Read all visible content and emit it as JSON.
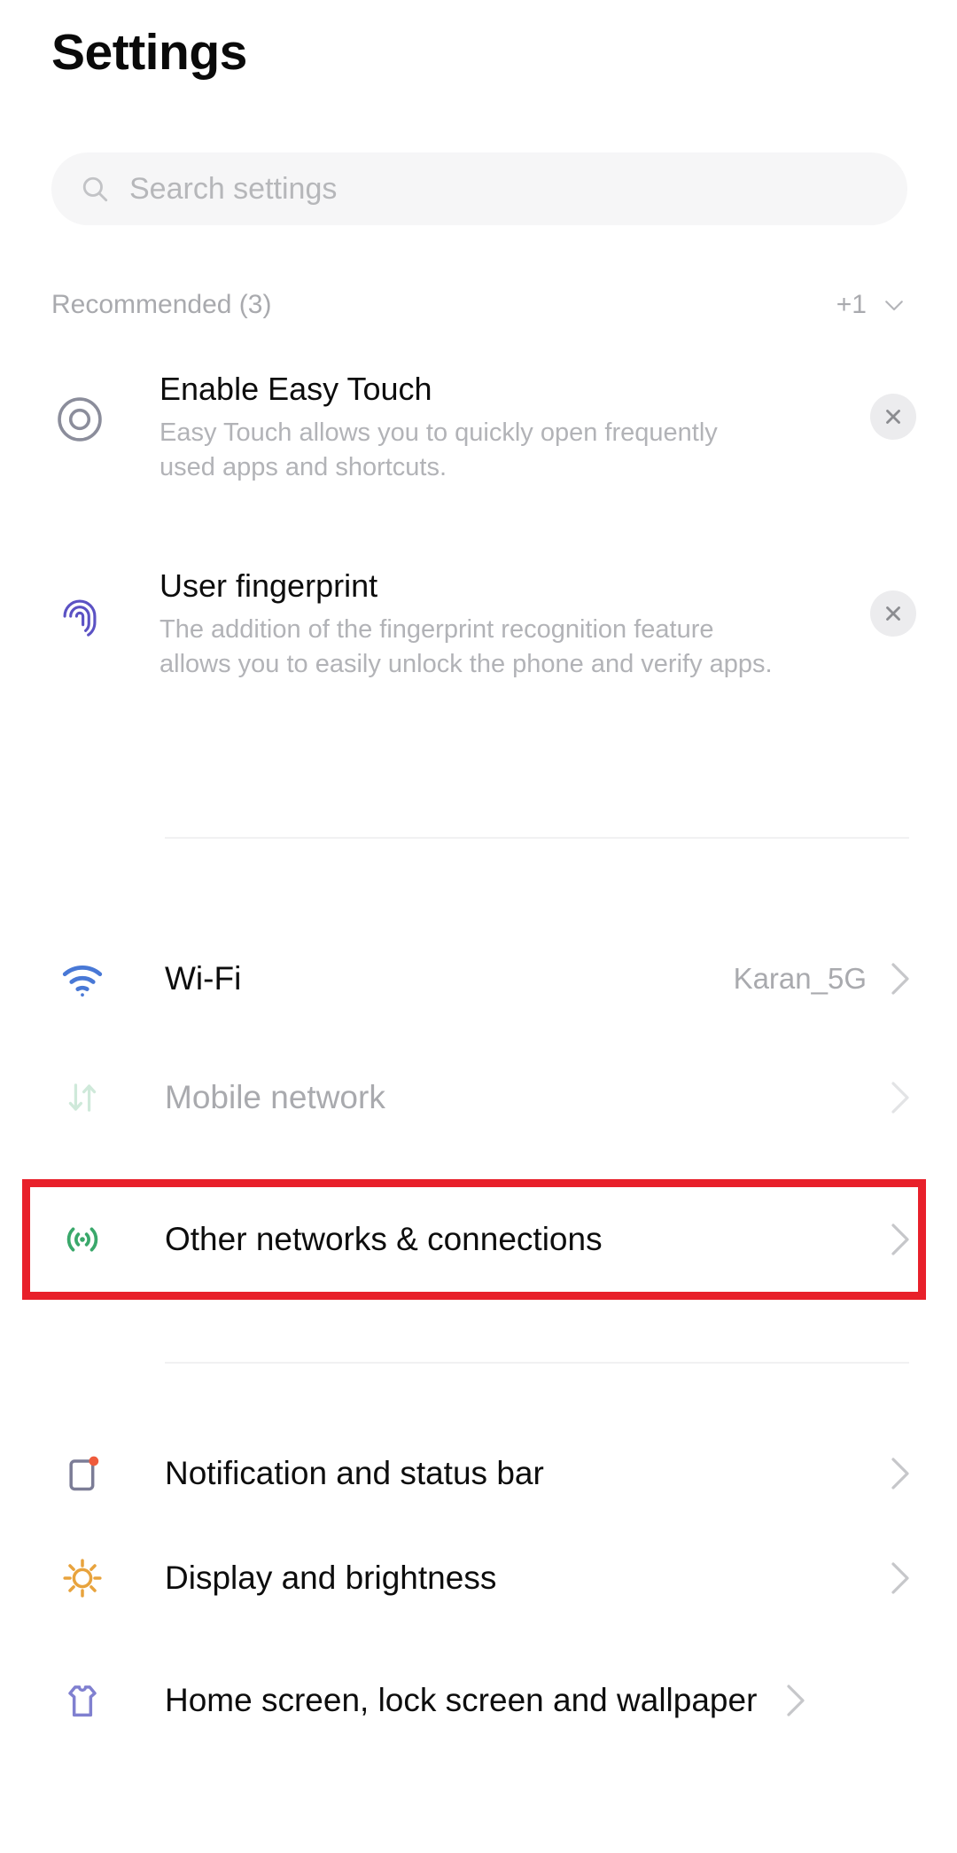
{
  "header": {
    "title": "Settings"
  },
  "search": {
    "placeholder": "Search settings",
    "icon": "search-icon"
  },
  "recommended": {
    "title": "Recommended (3)",
    "more_count": "+1",
    "expand_icon": "chevron-down-icon",
    "items": [
      {
        "name": "Enable Easy Touch",
        "description": "Easy Touch allows you to quickly open frequently used apps and shortcuts.",
        "icon": "easy-touch-icon",
        "icon_color": "#8b8d9b",
        "dismiss_icon": "close-icon"
      },
      {
        "name": "User fingerprint",
        "description": "The addition of the fingerprint recognition feature allows you to easily unlock the phone and verify apps.",
        "icon": "fingerprint-icon",
        "icon_color": "#5b52c4",
        "dismiss_icon": "close-icon"
      }
    ]
  },
  "network_group": {
    "rows": [
      {
        "label": "Wi-Fi",
        "value": "Karan_5G",
        "icon": "wifi-icon",
        "icon_color": "#4878d6",
        "chevron": "chevron-right-icon",
        "dimmed": false,
        "highlighted": false
      },
      {
        "label": "Mobile network",
        "value": "",
        "icon": "mobile-data-icon",
        "icon_color": "#cfe9da",
        "chevron": "chevron-right-icon",
        "dimmed": true,
        "highlighted": false
      },
      {
        "label": "Other networks & connections",
        "value": "",
        "icon": "broadcast-icon",
        "icon_color": "#3aa86b",
        "chevron": "chevron-right-icon",
        "dimmed": false,
        "highlighted": true
      }
    ]
  },
  "display_group": {
    "rows": [
      {
        "label": "Notification and status bar",
        "value": "",
        "icon": "notification-badge-icon",
        "icon_color": "#7b7c96",
        "badge_color": "#ef5b3c",
        "chevron": "chevron-right-icon"
      },
      {
        "label": "Display and brightness",
        "value": "",
        "icon": "brightness-sun-icon",
        "icon_color": "#e8a33d",
        "chevron": "chevron-right-icon"
      },
      {
        "label": "Home screen, lock screen and wallpaper",
        "value": "",
        "icon": "tshirt-wallpaper-icon",
        "icon_color": "#8080d0",
        "chevron": "chevron-right-icon"
      }
    ]
  },
  "highlight": {
    "target": "Other networks & connections",
    "color": "#e8202a"
  }
}
